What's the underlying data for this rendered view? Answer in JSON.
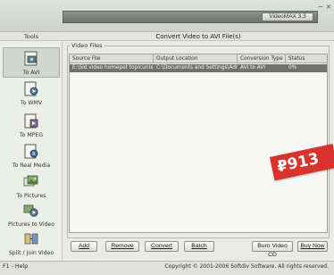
{
  "titlebar": {
    "product_badge": "VideoMAX 3.3",
    "minimize_glyph": "−",
    "close_glyph": "×"
  },
  "panel": {
    "tools_label": "Tools",
    "main_title": "Convert Video to AVI File(s)",
    "group_title": "Video Files"
  },
  "sidebar": {
    "items": [
      {
        "label": "To AVI",
        "icon": "video-file-avi-icon",
        "active": true
      },
      {
        "label": "To WMV",
        "icon": "video-file-wmv-icon",
        "active": false
      },
      {
        "label": "To MPEG",
        "icon": "video-file-mpeg-icon",
        "active": false
      },
      {
        "label": "To Real Media",
        "icon": "video-file-real-icon",
        "active": false
      },
      {
        "label": "To Pictures",
        "icon": "pictures-icon",
        "active": false
      },
      {
        "label": "Pictures to Video",
        "icon": "pictures-to-video-icon",
        "active": false
      },
      {
        "label": "Split / Join Video",
        "icon": "split-join-icon",
        "active": false
      }
    ]
  },
  "table": {
    "columns": [
      "Source File",
      "Output Location",
      "Conversion Type",
      "Status"
    ],
    "rows": [
      {
        "source": "E:\\Sid video homepet topicunix.avi",
        "output": "C:\\Documents and Settings\\Adm...",
        "type": "AVI to AVI",
        "status": "0%"
      }
    ]
  },
  "buttons": {
    "add": "Add",
    "remove": "Remove",
    "convert": "Convert",
    "batch": "Batch",
    "burn": "Burn Video CD",
    "buy": "Buy Now"
  },
  "status": {
    "left": "F1 - Help",
    "right": "Copyright © 2001-2006 Softdiv Software. All rights reserved."
  },
  "price_tag": "₽913",
  "colors": {
    "accent": "#d8332c",
    "selected_row": "#6f736c",
    "background": "#e9ebe4"
  }
}
